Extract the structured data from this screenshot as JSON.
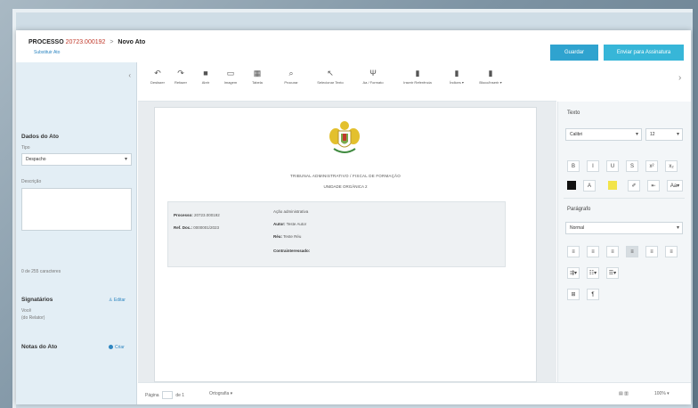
{
  "header": {
    "breadcrumb_root": "PROCESSO",
    "breadcrumb_number": "20723.000192",
    "breadcrumb_separator": ">",
    "breadcrumb_current": "Novo Ato",
    "sublink": "Substituir Ato",
    "save_label": "Guardar",
    "sign_label": "Enviar para Assinatura"
  },
  "sidebar": {
    "section_title": "Dados do Ato",
    "type_label": "Tipo",
    "type_value": "Despacho",
    "description_label": "Descrição",
    "char_counter": "0 de 255 caracteres",
    "signatories_title": "Signatários",
    "signatories_action": "Editar",
    "signatory_name": "Você",
    "signatory_role": "(do Relator)",
    "notes_title": "Notas do Ato",
    "notes_action": "Criar"
  },
  "toolbar": {
    "items": [
      {
        "icon": "undo-icon",
        "glyph": "↶",
        "label": "Desfazer"
      },
      {
        "icon": "redo-icon",
        "glyph": "↷",
        "label": "Refazer"
      },
      {
        "icon": "folder-icon",
        "glyph": "■",
        "label": "Abrir"
      },
      {
        "icon": "image-icon",
        "glyph": "▭",
        "label": "Imagem"
      },
      {
        "icon": "table-icon",
        "glyph": "▦",
        "label": "Tabela"
      },
      {
        "icon": "search-icon",
        "glyph": "⌕",
        "label": "Procurar"
      },
      {
        "icon": "cursor-icon",
        "glyph": "↖",
        "label": "Selecionar Texto"
      },
      {
        "icon": "text-format-icon",
        "glyph": "Ψ",
        "label": "Aa / Formato"
      },
      {
        "icon": "reference-icon",
        "glyph": "▮",
        "label": "Inserir Referência"
      },
      {
        "icon": "indexes-icon",
        "glyph": "▮",
        "label": "Índices ▾"
      },
      {
        "icon": "insert-block-icon",
        "glyph": "▮",
        "label": "Bloco/Inserir ▾"
      }
    ]
  },
  "document": {
    "org_line_1": "TRIBUNAL ADMINISTRATIVO / FISCAL DE FORMAÇÃO",
    "org_line_2": "UNIDADE ORGÂNICA 2",
    "process_label": "Processo:",
    "process_value": "20723.000192",
    "ref_label": "Ref. Doc.:",
    "ref_value": "0000001/2023",
    "action_line": "Ação administrativa",
    "author_label": "Autor:",
    "author_value": "Teste Autor",
    "defendant_label": "Réu:",
    "defendant_value": "Teste Réu",
    "counterparty_label": "Contrainteressado:"
  },
  "right_panel": {
    "text_title": "Texto",
    "font_value": "Calibri",
    "size_value": "12",
    "style_buttons": [
      "B",
      "I",
      "U",
      "S",
      "x²",
      "x₂"
    ],
    "color_buttons": [
      "A",
      "✐",
      "⇤",
      "Aa▾"
    ],
    "text_color": "#111111",
    "highlight_color": "#f2e44a",
    "paragraph_title": "Parágrafo",
    "paragraph_value": "Normal",
    "align_buttons": [
      "≡",
      "≡",
      "≡",
      "≡",
      "≡",
      "≡"
    ],
    "list_buttons": [
      "⇶▾",
      "☷▾",
      "☰▾"
    ],
    "misc_buttons": [
      "⊞",
      "¶"
    ]
  },
  "status": {
    "page_label": "Página",
    "page_value": "1",
    "page_of": "de 1",
    "view_mode": "Ortografia ▾",
    "zoom": "100% ▾"
  }
}
